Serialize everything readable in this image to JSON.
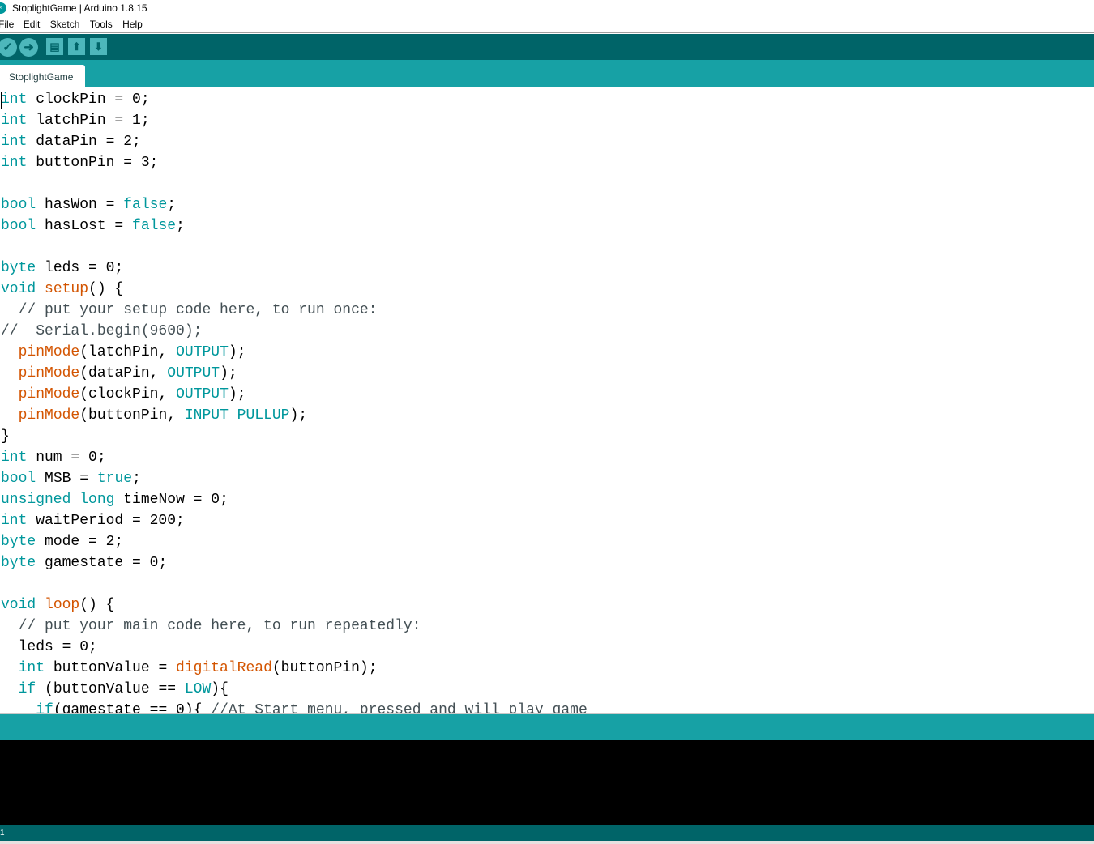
{
  "window": {
    "title": "StoplightGame | Arduino 1.8.15",
    "logo_text": "∞"
  },
  "menu": [
    "File",
    "Edit",
    "Sketch",
    "Tools",
    "Help"
  ],
  "toolbar": {
    "verify": "✓",
    "upload": "➜",
    "new": "▤",
    "open": "⬆",
    "save": "⬇"
  },
  "tab": {
    "label": "StoplightGame"
  },
  "colors": {
    "toolbar": "#006468",
    "tabbar": "#17a1a5",
    "keyword": "#00979c",
    "function": "#d35400",
    "comment": "#434f54"
  },
  "code": [
    [
      [
        "int",
        "kw"
      ],
      [
        " clockPin = 0;",
        "tx"
      ]
    ],
    [
      [
        "int",
        "kw"
      ],
      [
        " latchPin = 1;",
        "tx"
      ]
    ],
    [
      [
        "int",
        "kw"
      ],
      [
        " dataPin = 2;",
        "tx"
      ]
    ],
    [
      [
        "int",
        "kw"
      ],
      [
        " buttonPin = 3;",
        "tx"
      ]
    ],
    [],
    [
      [
        "bool",
        "kw"
      ],
      [
        " hasWon = ",
        "tx"
      ],
      [
        "false",
        "kw"
      ],
      [
        ";",
        "tx"
      ]
    ],
    [
      [
        "bool",
        "kw"
      ],
      [
        " hasLost = ",
        "tx"
      ],
      [
        "false",
        "kw"
      ],
      [
        ";",
        "tx"
      ]
    ],
    [],
    [
      [
        "byte",
        "kw"
      ],
      [
        " leds = 0;",
        "tx"
      ]
    ],
    [
      [
        "void",
        "kw"
      ],
      [
        " ",
        "tx"
      ],
      [
        "setup",
        "fn"
      ],
      [
        "() {",
        "tx"
      ]
    ],
    [
      [
        "  // put your setup code here, to run once:",
        "cm"
      ]
    ],
    [
      [
        "//  Serial.begin(9600);",
        "cm"
      ]
    ],
    [
      [
        "  ",
        "tx"
      ],
      [
        "pinMode",
        "fn"
      ],
      [
        "(latchPin, ",
        "tx"
      ],
      [
        "OUTPUT",
        "kw"
      ],
      [
        ");",
        "tx"
      ]
    ],
    [
      [
        "  ",
        "tx"
      ],
      [
        "pinMode",
        "fn"
      ],
      [
        "(dataPin, ",
        "tx"
      ],
      [
        "OUTPUT",
        "kw"
      ],
      [
        ");",
        "tx"
      ]
    ],
    [
      [
        "  ",
        "tx"
      ],
      [
        "pinMode",
        "fn"
      ],
      [
        "(clockPin, ",
        "tx"
      ],
      [
        "OUTPUT",
        "kw"
      ],
      [
        ");",
        "tx"
      ]
    ],
    [
      [
        "  ",
        "tx"
      ],
      [
        "pinMode",
        "fn"
      ],
      [
        "(buttonPin, ",
        "tx"
      ],
      [
        "INPUT_PULLUP",
        "kw"
      ],
      [
        ");",
        "tx"
      ]
    ],
    [
      [
        "}",
        "tx"
      ]
    ],
    [
      [
        "int",
        "kw"
      ],
      [
        " num = 0;",
        "tx"
      ]
    ],
    [
      [
        "bool",
        "kw"
      ],
      [
        " MSB = ",
        "tx"
      ],
      [
        "true",
        "kw"
      ],
      [
        ";",
        "tx"
      ]
    ],
    [
      [
        "unsigned",
        "kw"
      ],
      [
        " ",
        "tx"
      ],
      [
        "long",
        "kw"
      ],
      [
        " timeNow = 0;",
        "tx"
      ]
    ],
    [
      [
        "int",
        "kw"
      ],
      [
        " waitPeriod = 200;",
        "tx"
      ]
    ],
    [
      [
        "byte",
        "kw"
      ],
      [
        " mode = 2;",
        "tx"
      ]
    ],
    [
      [
        "byte",
        "kw"
      ],
      [
        " gamestate = 0;",
        "tx"
      ]
    ],
    [],
    [
      [
        "void",
        "kw"
      ],
      [
        " ",
        "tx"
      ],
      [
        "loop",
        "fn"
      ],
      [
        "() {",
        "tx"
      ]
    ],
    [
      [
        "  // put your main code here, to run repeatedly:",
        "cm"
      ]
    ],
    [
      [
        "  leds = 0;",
        "tx"
      ]
    ],
    [
      [
        "  ",
        "tx"
      ],
      [
        "int",
        "kw"
      ],
      [
        " buttonValue = ",
        "tx"
      ],
      [
        "digitalRead",
        "fn"
      ],
      [
        "(buttonPin);",
        "tx"
      ]
    ],
    [
      [
        "  ",
        "tx"
      ],
      [
        "if",
        "kw"
      ],
      [
        " (buttonValue == ",
        "tx"
      ],
      [
        "LOW",
        "kw"
      ],
      [
        "){",
        "tx"
      ]
    ],
    [
      [
        "    ",
        "tx"
      ],
      [
        "if",
        "kw"
      ],
      [
        "(gamestate == 0){ ",
        "tx"
      ],
      [
        "//At Start menu, pressed and will play game",
        "cm"
      ]
    ]
  ],
  "status": {
    "line_number": "1"
  }
}
